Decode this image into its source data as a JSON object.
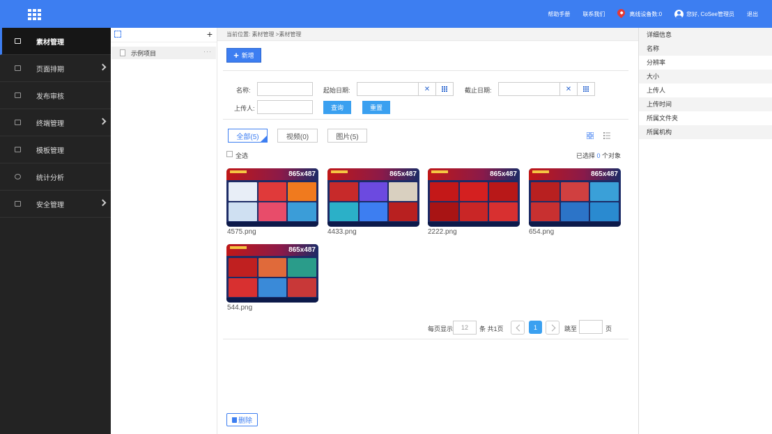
{
  "topbar": {
    "help": "帮助手册",
    "contact": "联系我们",
    "offline": "离线设备数:0",
    "greeting": "您好, CoSee管理员",
    "logout": "退出"
  },
  "sidebar": {
    "items": [
      {
        "label": "素材管理",
        "icon": "cube-icon"
      },
      {
        "label": "页面排期",
        "icon": "calendar-icon"
      },
      {
        "label": "发布审核",
        "icon": "clipboard-check-icon"
      },
      {
        "label": "终端管理",
        "icon": "monitor-icon"
      },
      {
        "label": "模板管理",
        "icon": "template-icon"
      },
      {
        "label": "统计分析",
        "icon": "pie-chart-icon"
      },
      {
        "label": "安全管理",
        "icon": "card-icon"
      }
    ]
  },
  "tree": {
    "project": "示例项目"
  },
  "main": {
    "breadcrumb": "当前位置: 素材管理 >素材管理",
    "new_label": "新增",
    "filters": {
      "name_label": "名称:",
      "start_label": "起始日期:",
      "end_label": "截止日期:",
      "uploader_label": "上传人:",
      "query_label": "查询",
      "reset_label": "重置"
    },
    "tabs": [
      {
        "label": "全部(5)"
      },
      {
        "label": "视频(0)"
      },
      {
        "label": "图片(5)"
      }
    ],
    "select_all": "全选",
    "selected_prefix": "已选择 ",
    "selected_count": "0",
    "selected_suffix": " 个对象",
    "resolution": "865x487",
    "files": [
      "4575.png",
      "4433.png",
      "2222.png",
      "654.png",
      "544.png"
    ],
    "pager": {
      "per_page_label": "每页显示",
      "per_page": "12",
      "pages_text": "条 共1页",
      "current": "1",
      "goto_label": "跳至",
      "page_unit": "页"
    },
    "delete_label": "删除"
  },
  "detail": {
    "title": "详细信息",
    "fields": [
      "名称",
      "分辨率",
      "大小",
      "上传人",
      "上传时间",
      "所属文件夹",
      "所属机构"
    ]
  },
  "colors": {
    "accent": "#3d7ef1",
    "sidebar": "#232323",
    "button": "#3aa0f0"
  }
}
